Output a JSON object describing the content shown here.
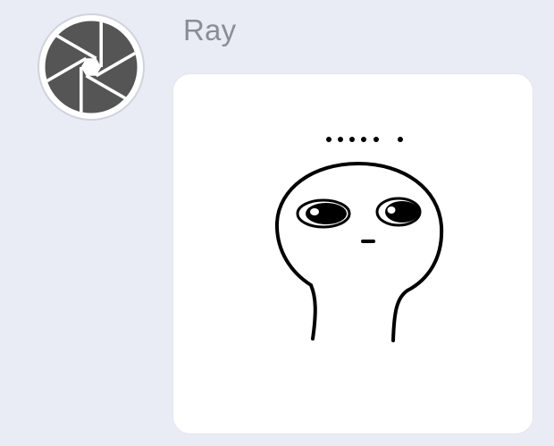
{
  "chat": {
    "message": {
      "sender_name": "Ray",
      "avatar_icon": "camera-aperture-icon",
      "content_type": "sticker",
      "sticker_icon": "speechless-blob-character-sticker"
    }
  },
  "colors": {
    "background": "#e9ecf5",
    "bubble": "#ffffff",
    "sender_name": "#8a8d96",
    "avatar_shutter": "#555555",
    "sticker_ink": "#000000"
  }
}
